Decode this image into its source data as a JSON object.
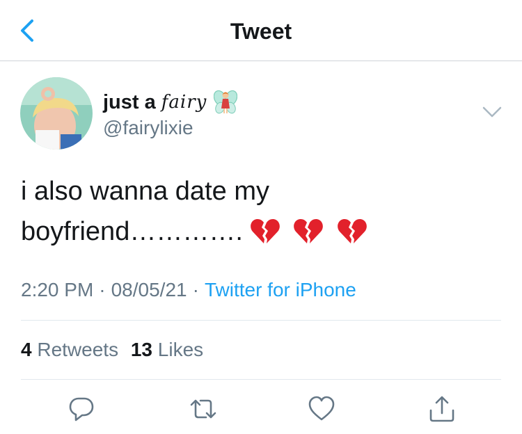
{
  "nav": {
    "title": "Tweet",
    "back_icon": "chevron-left-icon"
  },
  "author": {
    "name_plain": "just a",
    "name_stylized": "fairy",
    "name_emoji": "fairy-emoji",
    "handle": "@fairylixie",
    "avatar": "avatar"
  },
  "tweet": {
    "text_line1": "i also wanna date my",
    "text_line2": "boyfriend………….",
    "emojis": [
      "broken-heart",
      "broken-heart",
      "broken-heart"
    ]
  },
  "meta": {
    "time": "2:20 PM",
    "date": "08/05/21",
    "separator": "·",
    "source": "Twitter for iPhone"
  },
  "stats": {
    "retweets_count": "4",
    "retweets_label": "Retweets",
    "likes_count": "13",
    "likes_label": "Likes"
  },
  "actions": [
    "reply-icon",
    "retweet-icon",
    "like-icon",
    "share-icon"
  ],
  "colors": {
    "accent": "#1da1f2",
    "text": "#14171a",
    "secondary": "#657786",
    "divider": "#e1e8ed"
  }
}
